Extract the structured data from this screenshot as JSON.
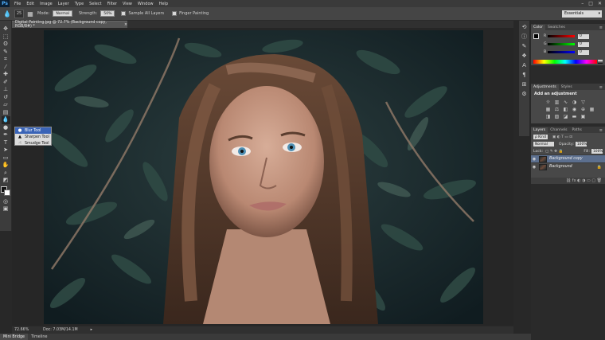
{
  "app": {
    "logo": "Ps",
    "menu": [
      "File",
      "Edit",
      "Image",
      "Layer",
      "Type",
      "Select",
      "Filter",
      "View",
      "Window",
      "Help"
    ],
    "window_controls": [
      "–",
      "□",
      "✕"
    ]
  },
  "options_bar": {
    "brush_size": "25",
    "mode_label": "Mode:",
    "mode_value": "Normal",
    "strength_label": "Strength:",
    "strength_value": "50%",
    "sample_all_layers": "Sample All Layers",
    "finger_painting": "Finger Painting",
    "workspace": "Essentials"
  },
  "tool_flyout": {
    "items": [
      {
        "label": "Blur Tool",
        "icon": "droplet-icon",
        "selected": true
      },
      {
        "label": "Sharpen Tool",
        "icon": "triangle-icon",
        "selected": false
      },
      {
        "label": "Smudge Tool",
        "icon": "finger-icon",
        "selected": false
      }
    ]
  },
  "document": {
    "tab_title": "Digital Painting.jpg @ 72.7% (Background copy, RGB/8#) *",
    "close": "×"
  },
  "status": {
    "zoom": "72.66%",
    "doc_info": "Doc: 7.03M/14.1M"
  },
  "bottom_tabs": [
    "Mini Bridge",
    "Timeline"
  ],
  "color_panel": {
    "tabs": [
      "Color",
      "Swatches"
    ],
    "sliders": [
      {
        "label": "R",
        "value": "0",
        "color": "#ff2a2a"
      },
      {
        "label": "G",
        "value": "0",
        "color": "#2aff2a"
      },
      {
        "label": "B",
        "value": "0",
        "color": "#2a5aff"
      }
    ]
  },
  "adjustments_panel": {
    "tabs": [
      "Adjustments",
      "Styles"
    ],
    "title": "Add an adjustment"
  },
  "layers_panel": {
    "tabs": [
      "Layers",
      "Channels",
      "Paths"
    ],
    "filter_label": "ρ Kind",
    "blend_mode": "Normal",
    "opacity_label": "Opacity:",
    "opacity_value": "100%",
    "lock_label": "Lock:",
    "fill_label": "Fill:",
    "fill_value": "100%",
    "layers": [
      {
        "name": "Background copy",
        "selected": true,
        "locked": false
      },
      {
        "name": "Background",
        "selected": false,
        "locked": true
      }
    ]
  }
}
